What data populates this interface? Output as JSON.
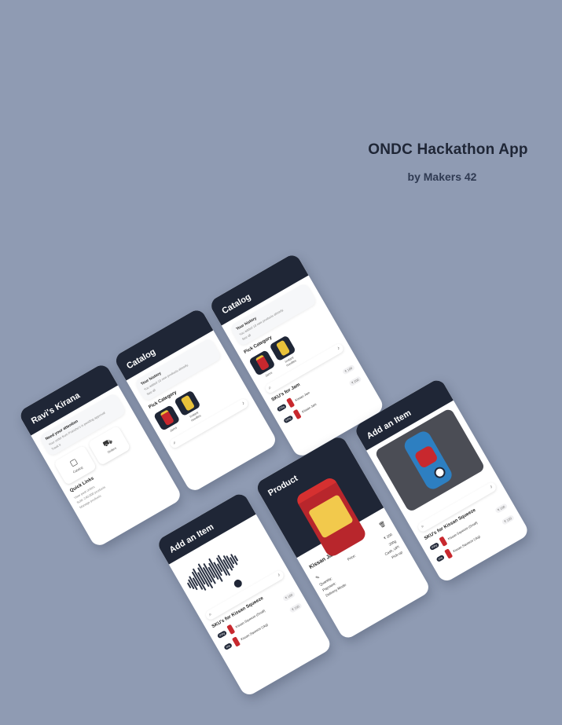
{
  "hero": {
    "title": "ONDC Hackathon App",
    "subtitle": "by Makers 42"
  },
  "screen_home": {
    "title": "Ravi's Kirana",
    "attention_title": "Need your attention",
    "attention_text": "Your order from Pranshu's is pending approval",
    "attention_link": "Track it",
    "tile_catalog": "Catalog",
    "tile_orders": "Orders",
    "quick_links": "Quick Links",
    "link_1": "View past orders",
    "link_2": "Sold: 240,000 products",
    "link_3": "Manage products"
  },
  "screen_catalog1": {
    "title": "Catalog",
    "history_title": "Your history",
    "history_text": "You added 10 new products already.",
    "history_link": "See all",
    "pick_category": "Pick Category",
    "cat_1": "Jams",
    "cat_2": "Instant noodles"
  },
  "screen_catalog2": {
    "title": "Catalog",
    "history_title": "Your history",
    "history_text": "You added 10 new products already.",
    "history_link": "See all",
    "pick_category": "Pick Category",
    "cat_1": "Jams",
    "cat_2": "Instant noodles",
    "sku_title": "SKU's for Jam",
    "sku_1_badge": "200g",
    "sku_1_name": "Kissan Jam",
    "sku_1_price": "₹ 100",
    "sku_2_badge": "500g",
    "sku_2_name": "Kissan Jam",
    "sku_2_price": "₹ 200"
  },
  "screen_product": {
    "title": "Product",
    "name": "Kissan Jam",
    "price_label": "Price:",
    "price_value": "₹ 200",
    "qty_label": "Quantity:",
    "qty_value": "200g",
    "payment_label": "Payment:",
    "payment_value": "Cash, UPI",
    "delivery_label": "Delivery Mode:",
    "delivery_value": "Pick-up"
  },
  "screen_add_voice": {
    "title": "Add an Item",
    "sku_title": "SKU's for Kissan Squeeze",
    "sku_1_badge": "500g",
    "sku_1_name": "Kissan Squeeze (Small)",
    "sku_1_price": "₹ 100",
    "sku_2_badge": "1kg",
    "sku_2_name": "Kissan Squeeze (1kg)",
    "sku_2_price": "₹ 150"
  },
  "screen_add_photo": {
    "title": "Add an Item",
    "sku_title": "SKU's for Kissan Squeeze",
    "sku_1_badge": "500g",
    "sku_1_name": "Kissan Squeeze (Small)",
    "sku_1_price": "₹ 100",
    "sku_2_badge": "1kg",
    "sku_2_name": "Kissan Squeeze (1kg)",
    "sku_2_price": "₹ 150"
  },
  "colors": {
    "background": "#8f9bb3",
    "header": "#1f2636",
    "card": "#ffffff"
  },
  "icons": [
    "catalog-icon",
    "cart-icon",
    "search-icon",
    "mic-icon",
    "edit-icon",
    "delete-icon",
    "record-icon"
  ]
}
